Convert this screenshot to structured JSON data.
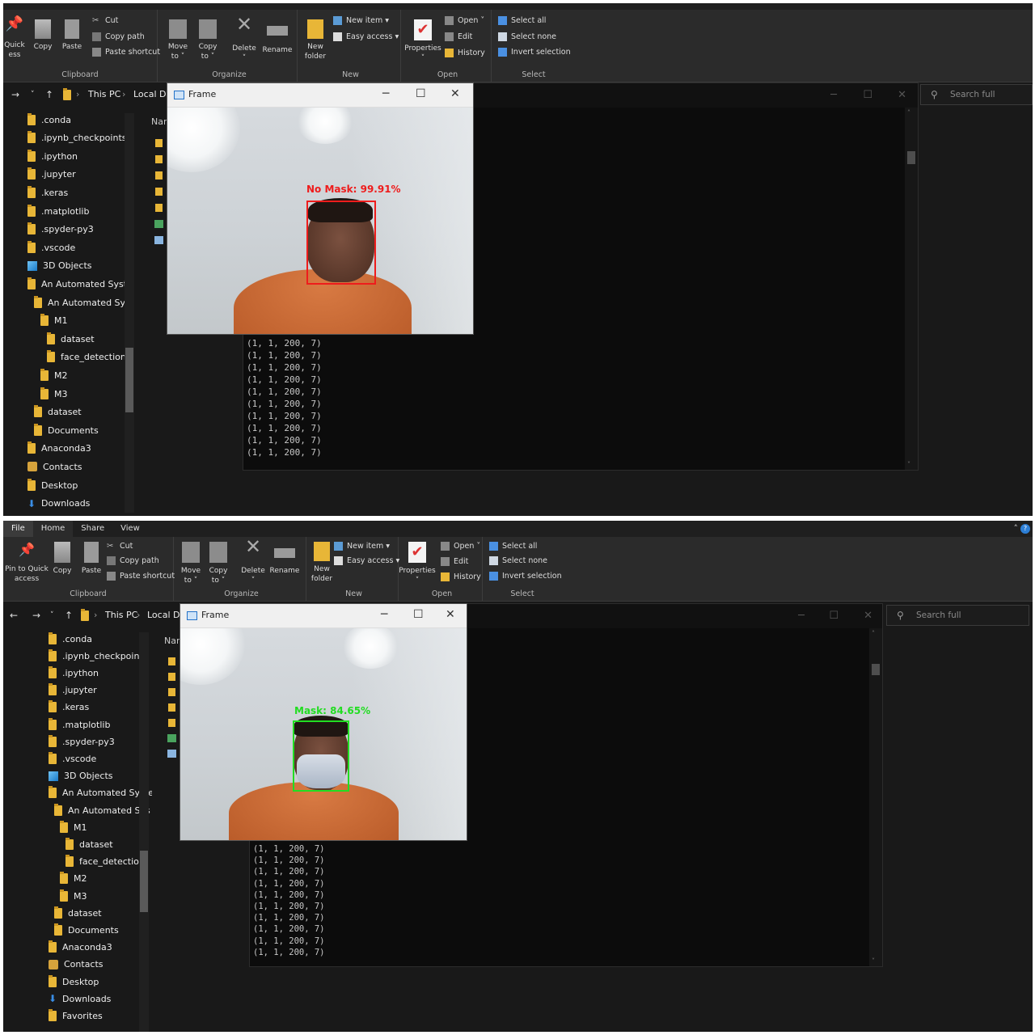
{
  "ribbon": {
    "tabs": [
      "File",
      "Home",
      "Share",
      "View"
    ],
    "groups": [
      "Clipboard",
      "Organize",
      "New",
      "Open",
      "Select"
    ],
    "buttons": {
      "pin": "Pin to Quick access",
      "pin_cropped": "Quick\ness",
      "copy": "Copy",
      "paste": "Paste",
      "cut": "Cut",
      "copy_path": "Copy path",
      "paste_shortcut": "Paste shortcut",
      "move_to": "Move\nto ˅",
      "copy_to": "Copy\nto ˅",
      "delete": "Delete",
      "rename": "Rename",
      "new_folder": "New\nfolder",
      "new_item": "New item ▾",
      "easy_access": "Easy access ▾",
      "properties": "Properties",
      "open": "Open ˅",
      "edit": "Edit",
      "history": "History",
      "select_all": "Select all",
      "select_none": "Select none",
      "invert_selection": "Invert selection"
    }
  },
  "address": {
    "this_pc": "This PC",
    "local_disk": "Local Di",
    "search_placeholder": "Search full"
  },
  "tree_top": [
    ".conda",
    ".ipynb_checkpoints",
    ".ipython",
    ".jupyter",
    ".keras",
    ".matplotlib",
    ".spyder-py3",
    ".vscode",
    "3D Objects",
    "An Automated Syste",
    "An Automated Sys",
    "M1",
    "dataset",
    "face_detection",
    "M2",
    "M3",
    "dataset",
    "Documents",
    "Anaconda3",
    "Contacts",
    "Desktop",
    "Downloads"
  ],
  "tree_bottom": [
    ".conda",
    ".ipynb_checkpoints",
    ".ipython",
    ".jupyter",
    ".keras",
    ".matplotlib",
    ".spyder-py3",
    ".vscode",
    "3D Objects",
    "An Automated Syste",
    "An Automated Sys",
    "M1",
    "dataset",
    "face_detection",
    "M2",
    "M3",
    "dataset",
    "Documents",
    "Anaconda3",
    "Contacts",
    "Desktop",
    "Downloads",
    "Favorites"
  ],
  "content": {
    "name_header": "Nar"
  },
  "frame": {
    "title": "Frame",
    "minimize": "─",
    "maximize": "☐",
    "close": "✕"
  },
  "detection_top": {
    "label": "No Mask: 99.91%",
    "color": "#ee1c1c"
  },
  "detection_bottom": {
    "label": "Mask: 84.65%",
    "color": "#22dd22"
  },
  "console": {
    "lines_top": [
      "(1, 1, 200, 7)",
      "(1, 1, 200, 7)",
      "(1, 1, 200, 7)",
      "(1, 1, 200, 7)",
      "(1, 1, 200, 7)",
      "(1, 1, 200, 7)",
      "(1, 1, 200, 7)",
      "(1, 1, 200, 7)",
      "(1, 1, 200, 7)",
      "(1, 1, 200, 7)"
    ],
    "lines_bottom": [
      "(1, 1, 200, 7)",
      "(1, 1, 200, 7)",
      "(1, 1, 200, 7)",
      "(1, 1, 200, 7)",
      "(1, 1, 200, 7)",
      "(1, 1, 200, 7)",
      "(1, 1, 200, 7)",
      "(1, 1, 200, 7)",
      "(1, 1, 200, 7)",
      "(1, 1, 200, 7)"
    ]
  }
}
